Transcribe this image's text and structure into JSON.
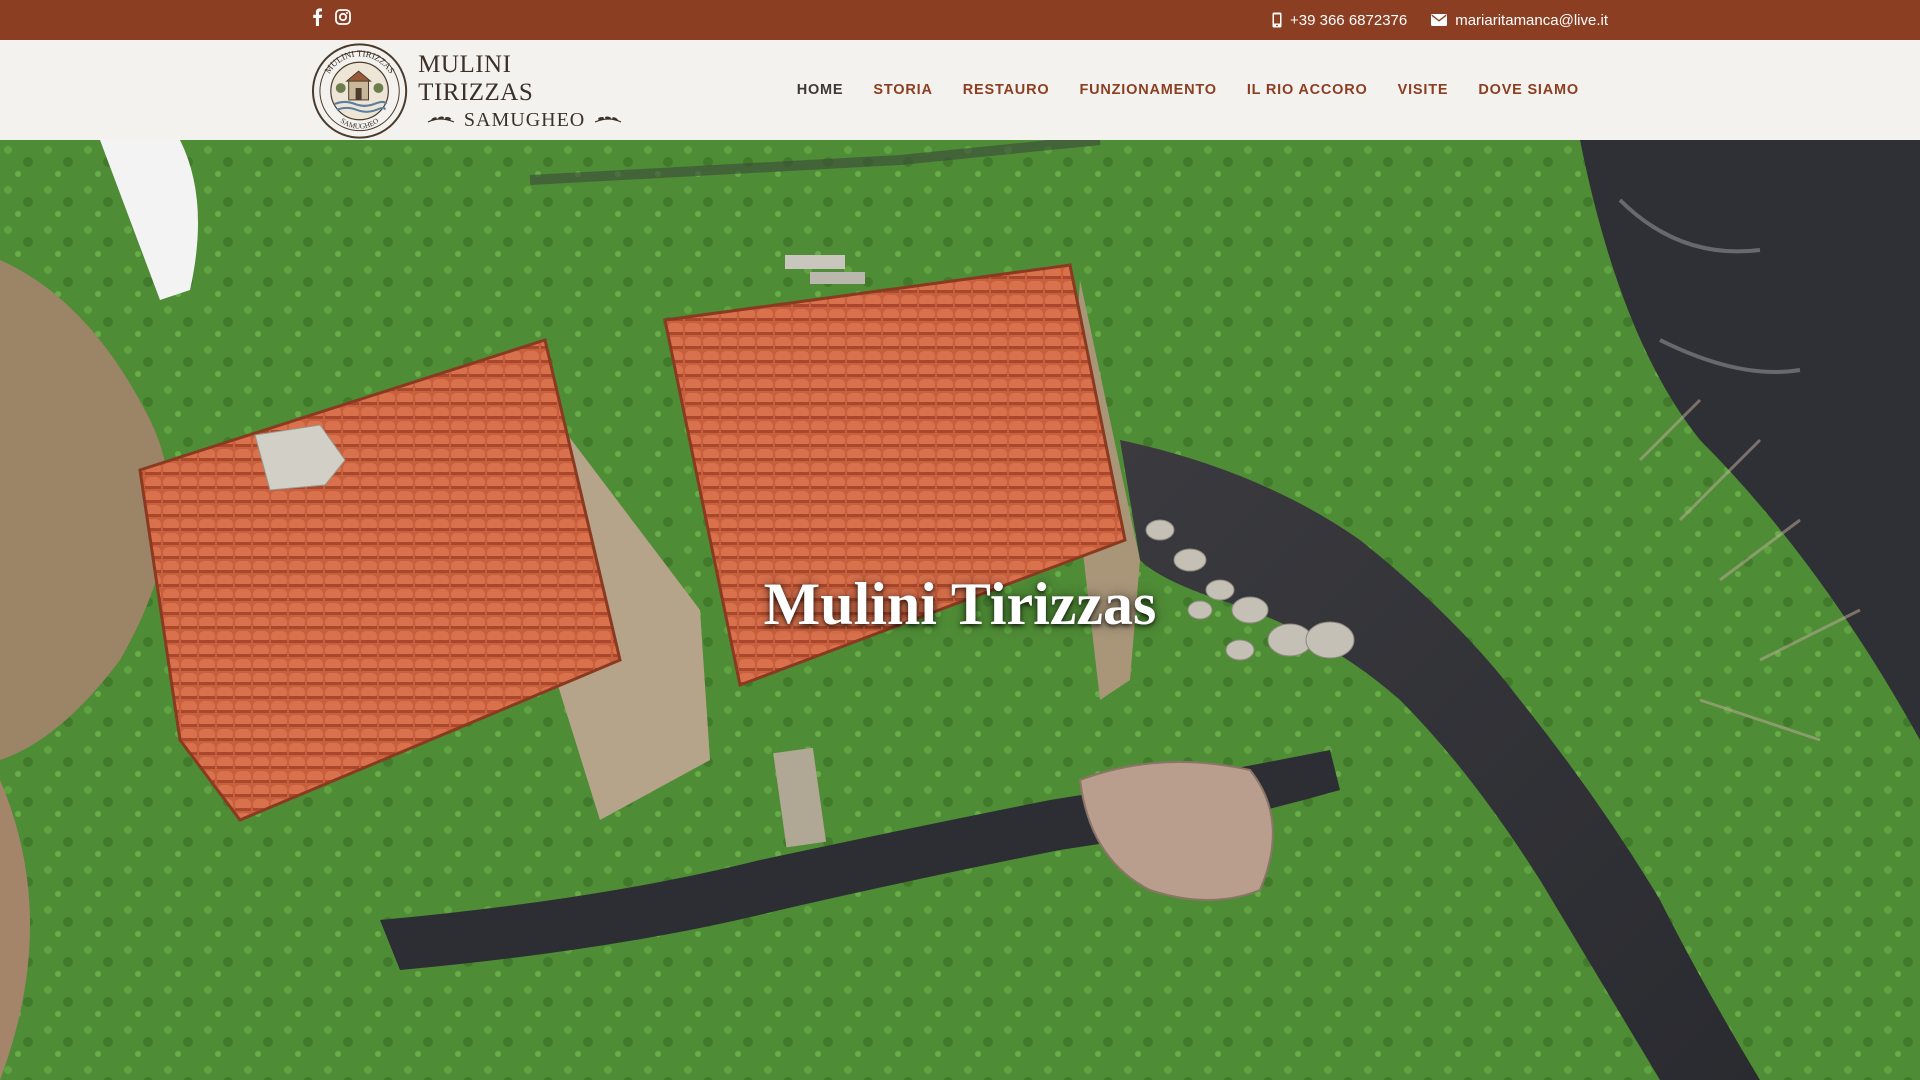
{
  "topbar": {
    "phone": "+39 366 6872376",
    "email": "mariaritamanca@live.it",
    "social": [
      "facebook-icon",
      "instagram-icon"
    ]
  },
  "logo": {
    "line1": "MULINI TIRIZZAS",
    "line2": "SAMUGHEO",
    "seal_top": "MULINI TIRIZZAS",
    "seal_bottom": "SAMUGHEO"
  },
  "nav": {
    "items": [
      {
        "label": "HOME"
      },
      {
        "label": "STORIA"
      },
      {
        "label": "RESTAURO"
      },
      {
        "label": "FUNZIONAMENTO"
      },
      {
        "label": "IL RIO ACCORO"
      },
      {
        "label": "VISITE"
      },
      {
        "label": "DOVE SIAMO"
      }
    ]
  },
  "hero": {
    "title": "Mulini Tirizzas"
  },
  "colors": {
    "brand": "#8b3e22",
    "header_bg": "#f4f2ee",
    "nav_active": "#3d3a36"
  }
}
